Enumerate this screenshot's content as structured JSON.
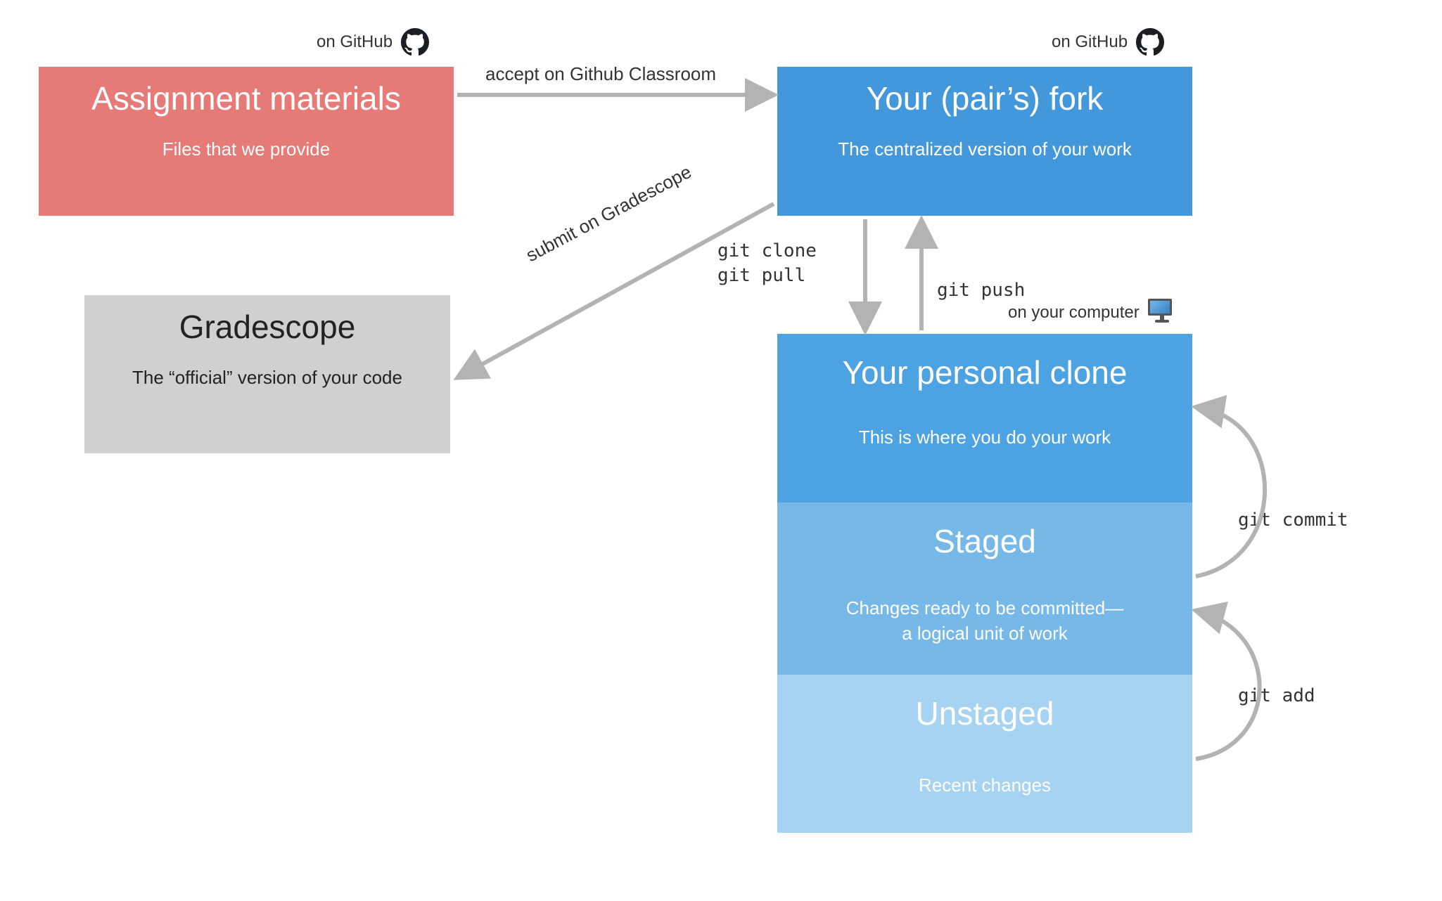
{
  "header": {
    "onGithub": "on GitHub",
    "onComputer": "on your computer"
  },
  "boxes": {
    "assignment": {
      "title": "Assignment materials",
      "desc": "Files that we provide"
    },
    "gradescope": {
      "title": "Gradescope",
      "desc": "The “official” version of your code"
    },
    "fork": {
      "title": "Your (pair’s) fork",
      "desc": "The centralized version of your work"
    },
    "clone": {
      "title": "Your personal clone",
      "desc": "This is where you do your work"
    },
    "staged": {
      "title": "Staged",
      "desc": "Changes ready to be committed—\na logical unit of work"
    },
    "unstaged": {
      "title": "Unstaged",
      "desc": "Recent changes"
    }
  },
  "arrows": {
    "accept": "accept on Github Classroom",
    "submit": "submit on Gradescope",
    "clone": "git clone",
    "pull": "git pull",
    "push": "git push",
    "commit": "git commit",
    "add": "git add"
  }
}
